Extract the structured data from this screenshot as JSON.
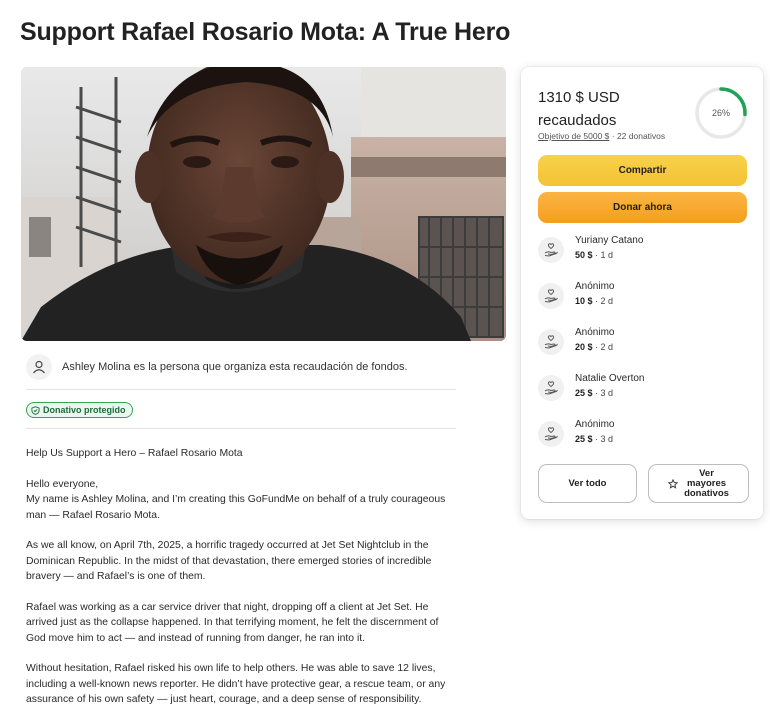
{
  "page": {
    "title": "Support Rafael Rosario Mota: A True Hero"
  },
  "organizer": {
    "text": "Ashley Molina es la persona que organiza esta recaudación de fondos."
  },
  "badge": {
    "label": "Donativo protegido"
  },
  "story": {
    "heading": "Help Us Support a Hero – Rafael Rosario Mota",
    "greeting": "Hello everyone,",
    "intro": "My name is Ashley Molina, and I’m creating this GoFundMe on behalf of a truly courageous man — Rafael Rosario Mota.",
    "p2": "As we all know, on April 7th, 2025, a horrific tragedy occurred at Jet Set Nightclub in the Dominican Republic. In the midst of that devastation, there emerged stories of incredible bravery — and Rafael’s is one of them.",
    "p3": "Rafael was working as a car service driver that night, dropping off a client at Jet Set. He arrived just as the collapse happened. In that terrifying moment, he felt the discernment of God move him to act — and instead of running from danger, he ran into it.",
    "p4": "Without hesitation, Rafael risked his own life to help others. He was able to save 12 lives, including a well-known news reporter. He didn’t have protective gear, a rescue team, or any assurance of his own safety — just heart, courage, and a deep sense of responsibility."
  },
  "donation_card": {
    "amount": "1310 $ USD recaudados",
    "goal_link": "Objetivo de 5000 $",
    "goal_separator": "·",
    "donation_count": "22 donativos",
    "progress_percent_label": "26%",
    "progress_fraction": 0.26,
    "share_label": "Compartir",
    "donate_label": "Donar ahora",
    "donors": [
      {
        "name": "Yuriany Catano",
        "amount": "50 $",
        "time": "· 1 d"
      },
      {
        "name": "Anónimo",
        "amount": "10 $",
        "time": "· 2 d"
      },
      {
        "name": "Anónimo",
        "amount": "20 $",
        "time": "· 2 d"
      },
      {
        "name": "Natalie Overton",
        "amount": "25 $",
        "time": "· 3 d"
      },
      {
        "name": "Anónimo",
        "amount": "25 $",
        "time": "· 3 d"
      }
    ],
    "see_all_label": "Ver todo",
    "top_donations_label": "Ver\nmayores\ndonativos"
  },
  "colors": {
    "progress": "#1fa35b",
    "share_button": "#f5c63c",
    "donate_button": "#f7a52b",
    "badge_border": "#3aa35a"
  }
}
